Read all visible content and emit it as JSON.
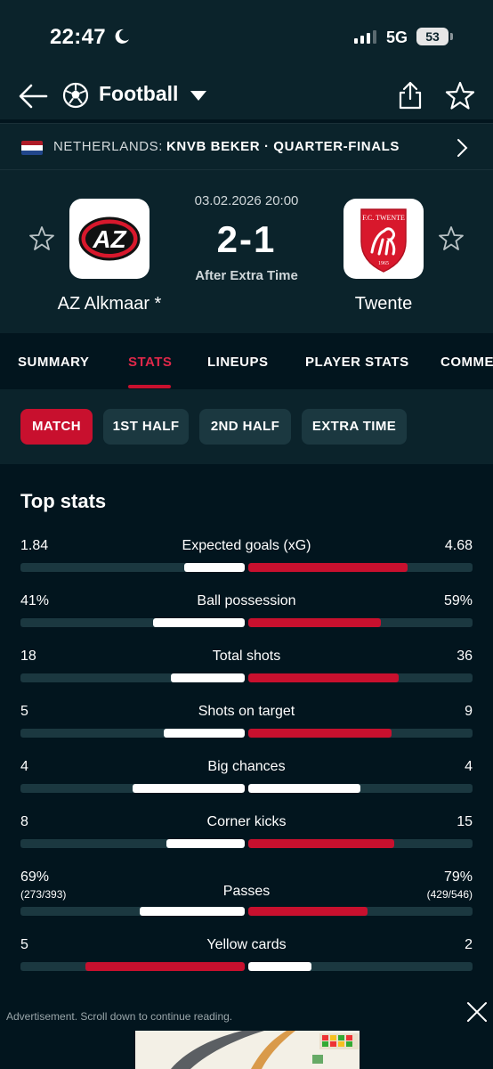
{
  "status_bar": {
    "time": "22:47",
    "network": "5G",
    "battery": "53"
  },
  "header": {
    "title": "Football"
  },
  "league": {
    "country": "NETHERLANDS:",
    "name": "KNVB BEKER · QUARTER-FINALS"
  },
  "match": {
    "date": "03.02.2026 20:00",
    "score": "2-1",
    "status": "After Extra Time",
    "home": {
      "name": "AZ Alkmaar *",
      "logo_text": "AZ"
    },
    "away": {
      "name": "Twente",
      "logo_text": "F.C. TWENTE",
      "logo_year": "1965"
    }
  },
  "tabs": [
    "SUMMARY",
    "STATS",
    "LINEUPS",
    "PLAYER STATS",
    "COMME"
  ],
  "active_tab": "STATS",
  "filters": [
    "MATCH",
    "1ST HALF",
    "2ND HALF",
    "EXTRA TIME"
  ],
  "active_filter": "MATCH",
  "section_title": "Top stats",
  "colors": {
    "accent": "#c8102e",
    "background": "#02151e",
    "panel": "#0b232b"
  },
  "stats": [
    {
      "label": "Expected goals (xG)",
      "home": "1.84",
      "away": "4.68",
      "home_fill": 0.27,
      "away_fill": 0.71,
      "leader": "away"
    },
    {
      "label": "Ball possession",
      "home": "41%",
      "away": "59%",
      "home_fill": 0.41,
      "away_fill": 0.59,
      "leader": "away"
    },
    {
      "label": "Total shots",
      "home": "18",
      "away": "36",
      "home_fill": 0.33,
      "away_fill": 0.67,
      "leader": "away"
    },
    {
      "label": "Shots on target",
      "home": "5",
      "away": "9",
      "home_fill": 0.36,
      "away_fill": 0.64,
      "leader": "away"
    },
    {
      "label": "Big chances",
      "home": "4",
      "away": "4",
      "home_fill": 0.5,
      "away_fill": 0.5,
      "leader": "none"
    },
    {
      "label": "Corner kicks",
      "home": "8",
      "away": "15",
      "home_fill": 0.35,
      "away_fill": 0.65,
      "leader": "away"
    },
    {
      "label": "Passes",
      "home": "69%",
      "away": "79%",
      "home_sub": "(273/393)",
      "away_sub": "(429/546)",
      "home_fill": 0.47,
      "away_fill": 0.53,
      "leader": "away"
    },
    {
      "label": "Yellow cards",
      "home": "5",
      "away": "2",
      "home_fill": 0.71,
      "away_fill": 0.28,
      "leader": "home"
    }
  ],
  "ad": {
    "text": "Advertisement. Scroll down to continue reading."
  }
}
